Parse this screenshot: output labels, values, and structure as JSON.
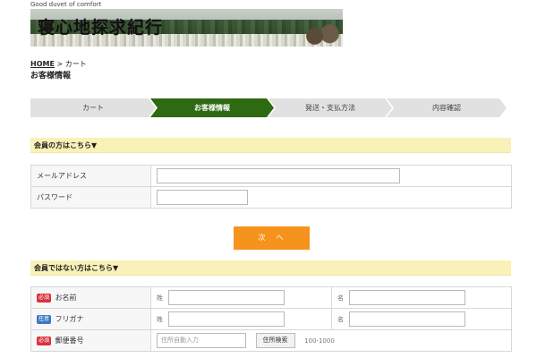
{
  "header": {
    "tagline": "Good duvet of comfort",
    "site_title": "寝心地探求紀行"
  },
  "breadcrumb": {
    "home": "HOME",
    "separator": ">",
    "current": "カート"
  },
  "page_title": "お客様情報",
  "steps": [
    {
      "label": "カート",
      "active": false
    },
    {
      "label": "お客様情報",
      "active": true
    },
    {
      "label": "発送・支払方法",
      "active": false
    },
    {
      "label": "内容確認",
      "active": false
    }
  ],
  "member_section": {
    "heading": "会員の方はこちら▼",
    "email_label": "メールアドレス",
    "password_label": "パスワード"
  },
  "next_button": "次　へ",
  "guest_section": {
    "heading": "会員ではない方はこちら▼",
    "required_badge": "必須",
    "optional_badge": "任意",
    "name_label": "お名前",
    "kana_label": "フリガナ",
    "postal_label": "郵便番号",
    "last_name_sub": "姓",
    "first_name_sub": "名",
    "postal_placeholder": "住所自動入力",
    "address_search_button": "住所検索",
    "postal_hint": "100-1000"
  },
  "colors": {
    "active_step": "#2d6a12",
    "section_bar": "#f9f1b8",
    "next_button": "#f6931d",
    "required": "#d9333f",
    "optional": "#3c78c8"
  }
}
